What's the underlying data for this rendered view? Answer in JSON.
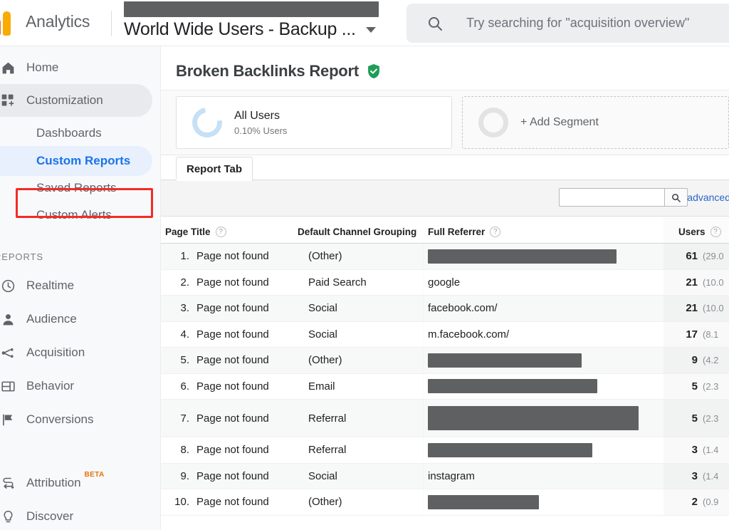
{
  "topbar": {
    "brand": "Analytics",
    "logo_icon": "analytics-logo-icon",
    "account_name": "World Wide Users - Backup ...",
    "account_masked": true,
    "caret_icon": "chevron-down-icon",
    "search_icon": "search-icon",
    "search_placeholder": "Try searching for \"acquisition overview\"",
    "search_value": ""
  },
  "sidebar": {
    "primary": [
      {
        "label": "Home",
        "icon": "home-icon"
      },
      {
        "label": "Customization",
        "icon": "customization-icon"
      }
    ],
    "custom_sub": [
      {
        "label": "Dashboards"
      },
      {
        "label": "Custom Reports"
      },
      {
        "label": "Saved Reports"
      },
      {
        "label": "Custom Alerts"
      }
    ],
    "selected_sub": "Custom Reports",
    "section_label": "REPORTS",
    "reports": [
      {
        "label": "Realtime",
        "icon": "clock-icon"
      },
      {
        "label": "Audience",
        "icon": "person-icon"
      },
      {
        "label": "Acquisition",
        "icon": "acquisition-icon"
      },
      {
        "label": "Behavior",
        "icon": "behavior-icon"
      },
      {
        "label": "Conversions",
        "icon": "flag-icon"
      }
    ],
    "footer": [
      {
        "label": "Attribution",
        "icon": "attribution-icon",
        "badge": "BETA"
      },
      {
        "label": "Discover",
        "icon": "lightbulb-icon"
      }
    ],
    "highlight_color": "#f42b25",
    "selected_color": "#1a73e8"
  },
  "report": {
    "title": "Broken Backlinks Report",
    "verified_icon": "verified-shield-icon",
    "verified_color": "#1e9e57"
  },
  "segments": [
    {
      "name": "All Users",
      "sub": "0.10% Users",
      "icon": "donut-chart-icon",
      "type": "applied"
    },
    {
      "name": "+ Add Segment",
      "icon": "donut-empty-icon",
      "type": "add"
    }
  ],
  "tabs": [
    {
      "label": "Report Tab",
      "selected": true
    }
  ],
  "toolbar": {
    "search_value": "",
    "search_button_icon": "search-icon",
    "advanced_label": "advanced"
  },
  "table": {
    "columns": [
      {
        "label": "Page Title",
        "help": true
      },
      {
        "label": "Default Channel Grouping",
        "help": false
      },
      {
        "label": "Full Referrer",
        "help": true
      },
      {
        "label": "Users",
        "help": true
      }
    ],
    "rows": [
      {
        "idx": "1.",
        "page_title": "Page not found",
        "channel": "(Other)",
        "referrer": "",
        "referrer_masked": true,
        "mask_w": 265,
        "users": "61",
        "pct": "(29.0"
      },
      {
        "idx": "2.",
        "page_title": "Page not found",
        "channel": "Paid Search",
        "referrer": "google",
        "referrer_masked": false,
        "mask_w": 0,
        "users": "21",
        "pct": "(10.0"
      },
      {
        "idx": "3.",
        "page_title": "Page not found",
        "channel": "Social",
        "referrer": "facebook.com/",
        "referrer_masked": false,
        "mask_w": 0,
        "users": "21",
        "pct": "(10.0"
      },
      {
        "idx": "4.",
        "page_title": "Page not found",
        "channel": "Social",
        "referrer": "m.facebook.com/",
        "referrer_masked": false,
        "mask_w": 0,
        "users": "17",
        "pct": "(8.1"
      },
      {
        "idx": "5.",
        "page_title": "Page not found",
        "channel": "(Other)",
        "referrer": "",
        "referrer_masked": true,
        "mask_w": 216,
        "users": "9",
        "pct": "(4.2"
      },
      {
        "idx": "6.",
        "page_title": "Page not found",
        "channel": "Email",
        "referrer": "",
        "referrer_masked": true,
        "mask_w": 238,
        "users": "5",
        "pct": "(2.3"
      },
      {
        "idx": "7.",
        "page_title": "Page not found",
        "channel": "Referral",
        "referrer": "",
        "referrer_masked": true,
        "mask_w": 296,
        "users": "5",
        "pct": "(2.3",
        "tall": true
      },
      {
        "idx": "8.",
        "page_title": "Page not found",
        "channel": "Referral",
        "referrer": "",
        "referrer_masked": true,
        "mask_w": 231,
        "users": "3",
        "pct": "(1.4"
      },
      {
        "idx": "9.",
        "page_title": "Page not found",
        "channel": "Social",
        "referrer": "instagram",
        "referrer_masked": false,
        "mask_w": 0,
        "users": "3",
        "pct": "(1.4"
      },
      {
        "idx": "10.",
        "page_title": "Page not found",
        "channel": "(Other)",
        "referrer": "",
        "referrer_masked": true,
        "mask_w": 156,
        "users": "2",
        "pct": "(0.9"
      }
    ]
  }
}
